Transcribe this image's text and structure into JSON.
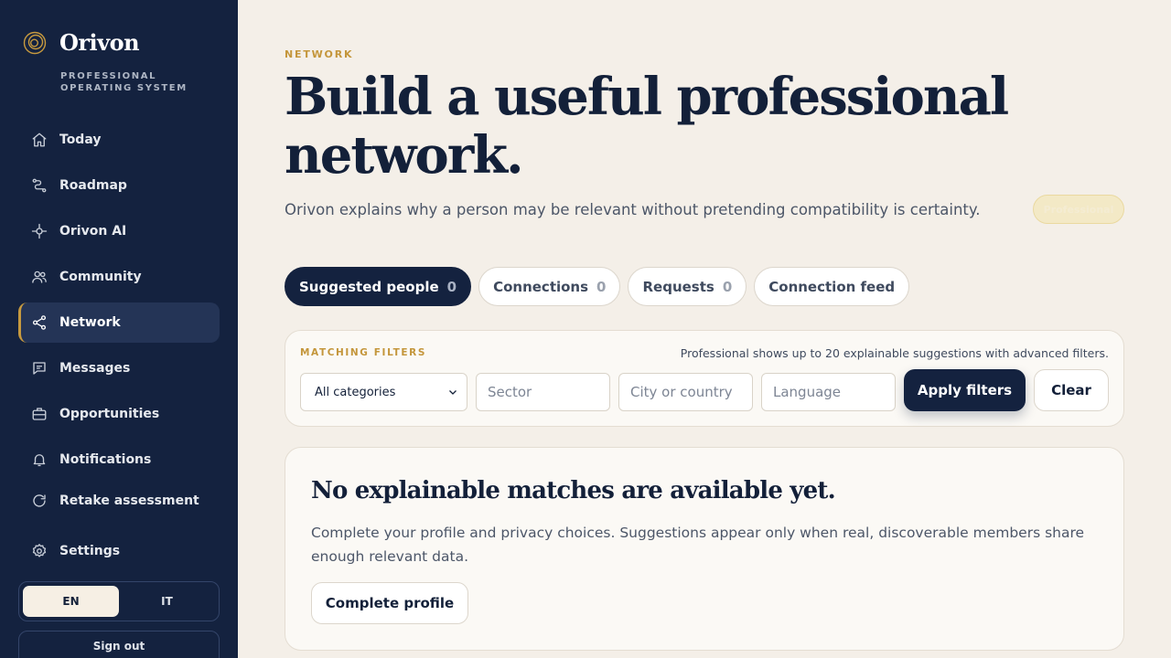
{
  "brand": {
    "name": "Orivon",
    "tagline": "PROFESSIONAL OPERATING SYSTEM",
    "logo_icon": "spiral-logo-icon",
    "accent": "#c79a3f"
  },
  "sidebar": {
    "items": [
      {
        "label": "Today",
        "icon": "home-icon"
      },
      {
        "label": "Roadmap",
        "icon": "route-icon"
      },
      {
        "label": "Orivon AI",
        "icon": "sparkle-icon"
      },
      {
        "label": "Community",
        "icon": "users-icon"
      },
      {
        "label": "Network",
        "icon": "share-icon",
        "active": true
      },
      {
        "label": "Messages",
        "icon": "message-icon"
      },
      {
        "label": "Opportunities",
        "icon": "briefcase-icon"
      },
      {
        "label": "Notifications",
        "icon": "bell-icon"
      },
      {
        "label": "Retake assessment",
        "icon": "refresh-icon"
      },
      {
        "label": "Settings",
        "icon": "gear-icon"
      }
    ],
    "language": {
      "options": [
        "EN",
        "IT"
      ],
      "selected": "EN"
    },
    "signout_label": "Sign out"
  },
  "header": {
    "eyebrow": "NETWORK",
    "title": "Build a useful professional network.",
    "subtitle": "Orivon explains why a person may be relevant without pretending compatibility is certainty.",
    "plan_badge": "Professional"
  },
  "tabs": [
    {
      "label": "Suggested people",
      "count": "0",
      "active": true
    },
    {
      "label": "Connections",
      "count": "0"
    },
    {
      "label": "Requests",
      "count": "0"
    },
    {
      "label": "Connection feed"
    }
  ],
  "filters": {
    "label": "MATCHING FILTERS",
    "note": "Professional shows up to 20 explainable suggestions with advanced filters.",
    "category_value": "All categories",
    "sector_placeholder": "Sector",
    "location_placeholder": "City or country",
    "language_placeholder": "Language",
    "apply_label": "Apply filters",
    "clear_label": "Clear"
  },
  "empty_state": {
    "title": "No explainable matches are available yet.",
    "text": "Complete your profile and privacy choices. Suggestions appear only when real, discoverable members share enough relevant data.",
    "button_label": "Complete profile"
  },
  "colors": {
    "sidebar_bg": "#14223f",
    "page_bg": "#f4efe8",
    "primary": "#14223f",
    "accent": "#c4963b"
  }
}
